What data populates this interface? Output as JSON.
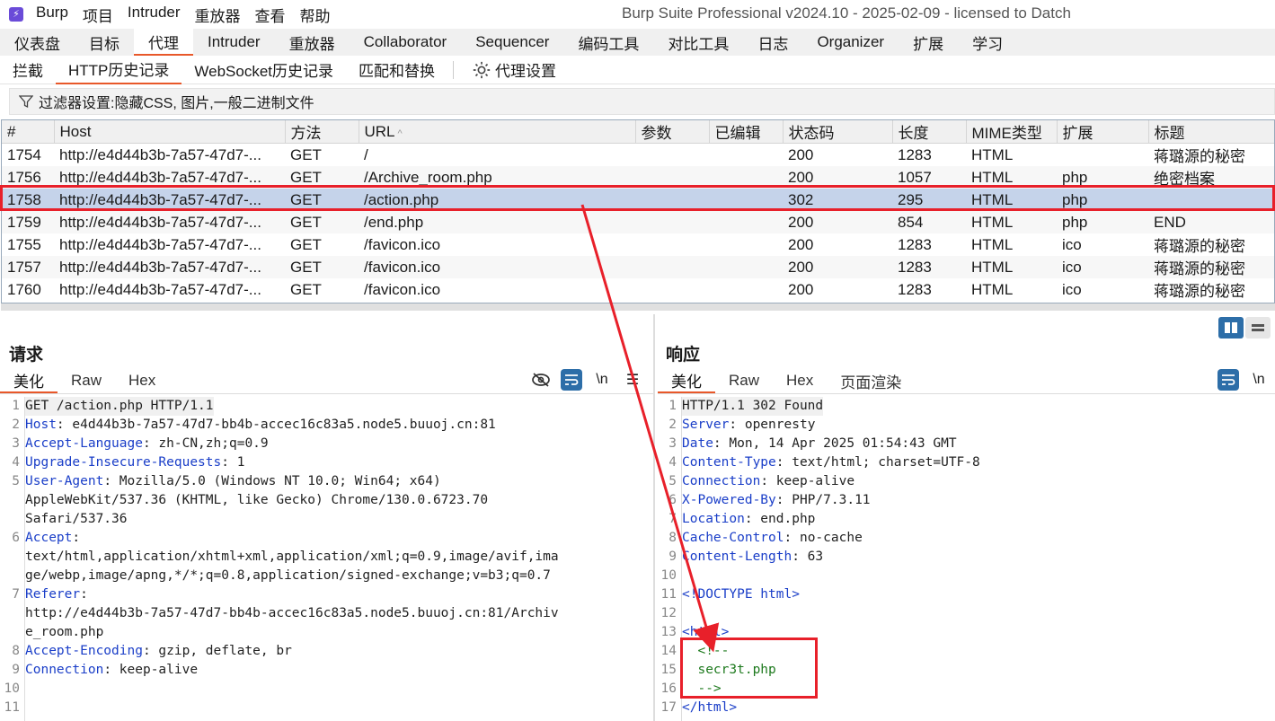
{
  "menubar": {
    "items": [
      "Burp",
      "项目",
      "Intruder",
      "重放器",
      "查看",
      "帮助"
    ],
    "window_title": "Burp Suite Professional v2024.10 - 2025-02-09 - licensed to Datch"
  },
  "main_tabs": [
    {
      "label": "仪表盘"
    },
    {
      "label": "目标"
    },
    {
      "label": "代理",
      "active": true
    },
    {
      "label": "Intruder"
    },
    {
      "label": "重放器"
    },
    {
      "label": "Collaborator"
    },
    {
      "label": "Sequencer"
    },
    {
      "label": "编码工具"
    },
    {
      "label": "对比工具"
    },
    {
      "label": "日志"
    },
    {
      "label": "Organizer"
    },
    {
      "label": "扩展"
    },
    {
      "label": "学习"
    }
  ],
  "sub_tabs": {
    "items": [
      "拦截",
      "HTTP历史记录",
      "WebSocket历史记录",
      "匹配和替换"
    ],
    "active": "HTTP历史记录",
    "settings_label": "代理设置"
  },
  "filter": {
    "text": "过滤器设置:隐藏CSS, 图片,一般二进制文件"
  },
  "history": {
    "columns": [
      "#",
      "Host",
      "方法",
      "URL",
      "参数",
      "已编辑",
      "状态码",
      "长度",
      "MIME类型",
      "扩展",
      "标题"
    ],
    "rows": [
      {
        "num": "1754",
        "host": "http://e4d44b3b-7a57-47d7-...",
        "method": "GET",
        "url": "/",
        "params": "",
        "edited": "",
        "status": "200",
        "length": "1283",
        "mime": "HTML",
        "ext": "",
        "title": "蒋璐源的秘密"
      },
      {
        "num": "1756",
        "host": "http://e4d44b3b-7a57-47d7-...",
        "method": "GET",
        "url": "/Archive_room.php",
        "params": "",
        "edited": "",
        "status": "200",
        "length": "1057",
        "mime": "HTML",
        "ext": "php",
        "title": "绝密档案"
      },
      {
        "num": "1758",
        "host": "http://e4d44b3b-7a57-47d7-...",
        "method": "GET",
        "url": "/action.php",
        "params": "",
        "edited": "",
        "status": "302",
        "length": "295",
        "mime": "HTML",
        "ext": "php",
        "title": ""
      },
      {
        "num": "1759",
        "host": "http://e4d44b3b-7a57-47d7-...",
        "method": "GET",
        "url": "/end.php",
        "params": "",
        "edited": "",
        "status": "200",
        "length": "854",
        "mime": "HTML",
        "ext": "php",
        "title": "END"
      },
      {
        "num": "1755",
        "host": "http://e4d44b3b-7a57-47d7-...",
        "method": "GET",
        "url": "/favicon.ico",
        "params": "",
        "edited": "",
        "status": "200",
        "length": "1283",
        "mime": "HTML",
        "ext": "ico",
        "title": "蒋璐源的秘密"
      },
      {
        "num": "1757",
        "host": "http://e4d44b3b-7a57-47d7-...",
        "method": "GET",
        "url": "/favicon.ico",
        "params": "",
        "edited": "",
        "status": "200",
        "length": "1283",
        "mime": "HTML",
        "ext": "ico",
        "title": "蒋璐源的秘密"
      },
      {
        "num": "1760",
        "host": "http://e4d44b3b-7a57-47d7-...",
        "method": "GET",
        "url": "/favicon.ico",
        "params": "",
        "edited": "",
        "status": "200",
        "length": "1283",
        "mime": "HTML",
        "ext": "ico",
        "title": "蒋璐源的秘密"
      }
    ],
    "selected_row": "1758"
  },
  "request": {
    "title": "请求",
    "tabs": [
      "美化",
      "Raw",
      "Hex"
    ],
    "newline_label": "\\n",
    "lines": [
      {
        "n": "1",
        "parts": [
          {
            "t": "GET /action.php HTTP/1.1",
            "c": "hval"
          }
        ]
      },
      {
        "n": "2",
        "parts": [
          {
            "t": "Host",
            "c": "hkey"
          },
          {
            "t": ": e4d44b3b-7a57-47d7-bb4b-accec16c83a5.node5.buuoj.cn:81",
            "c": "hval"
          }
        ]
      },
      {
        "n": "3",
        "parts": [
          {
            "t": "Accept-Language",
            "c": "hkey"
          },
          {
            "t": ": zh-CN,zh;q=0.9",
            "c": "hval"
          }
        ]
      },
      {
        "n": "4",
        "parts": [
          {
            "t": "Upgrade-Insecure-Requests",
            "c": "hkey"
          },
          {
            "t": ": 1",
            "c": "hval"
          }
        ]
      },
      {
        "n": "5",
        "parts": [
          {
            "t": "User-Agent",
            "c": "hkey"
          },
          {
            "t": ": Mozilla/5.0 (Windows NT 10.0; Win64; x64)",
            "c": "hval"
          }
        ]
      },
      {
        "n": "",
        "parts": [
          {
            "t": "AppleWebKit/537.36 (KHTML, like Gecko) Chrome/130.0.6723.70",
            "c": "hval"
          }
        ]
      },
      {
        "n": "",
        "parts": [
          {
            "t": "Safari/537.36",
            "c": "hval"
          }
        ]
      },
      {
        "n": "6",
        "parts": [
          {
            "t": "Accept",
            "c": "hkey"
          },
          {
            "t": ":",
            "c": "hval"
          }
        ]
      },
      {
        "n": "",
        "parts": [
          {
            "t": "text/html,application/xhtml+xml,application/xml;q=0.9,image/avif,ima",
            "c": "hval"
          }
        ]
      },
      {
        "n": "",
        "parts": [
          {
            "t": "ge/webp,image/apng,*/*;q=0.8,application/signed-exchange;v=b3;q=0.7",
            "c": "hval"
          }
        ]
      },
      {
        "n": "7",
        "parts": [
          {
            "t": "Referer",
            "c": "hkey"
          },
          {
            "t": ":",
            "c": "hval"
          }
        ]
      },
      {
        "n": "",
        "parts": [
          {
            "t": "http://e4d44b3b-7a57-47d7-bb4b-accec16c83a5.node5.buuoj.cn:81/Archiv",
            "c": "hval"
          }
        ]
      },
      {
        "n": "",
        "parts": [
          {
            "t": "e_room.php",
            "c": "hval"
          }
        ]
      },
      {
        "n": "8",
        "parts": [
          {
            "t": "Accept-Encoding",
            "c": "hkey"
          },
          {
            "t": ": gzip, deflate, br",
            "c": "hval"
          }
        ]
      },
      {
        "n": "9",
        "parts": [
          {
            "t": "Connection",
            "c": "hkey"
          },
          {
            "t": ": keep-alive",
            "c": "hval"
          }
        ]
      },
      {
        "n": "10",
        "parts": [
          {
            "t": "",
            "c": "hval"
          }
        ]
      },
      {
        "n": "11",
        "parts": [
          {
            "t": "",
            "c": "hval"
          }
        ]
      }
    ]
  },
  "response": {
    "title": "响应",
    "tabs": [
      "美化",
      "Raw",
      "Hex",
      "页面渲染"
    ],
    "newline_label": "\\n",
    "lines": [
      {
        "n": "1",
        "parts": [
          {
            "t": "HTTP/1.1 302 Found",
            "c": "hval"
          }
        ]
      },
      {
        "n": "2",
        "parts": [
          {
            "t": "Server",
            "c": "hkey"
          },
          {
            "t": ": openresty",
            "c": "hval"
          }
        ]
      },
      {
        "n": "3",
        "parts": [
          {
            "t": "Date",
            "c": "hkey"
          },
          {
            "t": ": Mon, 14 Apr 2025 01:54:43 GMT",
            "c": "hval"
          }
        ]
      },
      {
        "n": "4",
        "parts": [
          {
            "t": "Content-Type",
            "c": "hkey"
          },
          {
            "t": ": text/html; charset=UTF-8",
            "c": "hval"
          }
        ]
      },
      {
        "n": "5",
        "parts": [
          {
            "t": "Connection",
            "c": "hkey"
          },
          {
            "t": ": keep-alive",
            "c": "hval"
          }
        ]
      },
      {
        "n": "6",
        "parts": [
          {
            "t": "X-Powered-By",
            "c": "hkey"
          },
          {
            "t": ": PHP/7.3.11",
            "c": "hval"
          }
        ]
      },
      {
        "n": "7",
        "parts": [
          {
            "t": "Location",
            "c": "hkey"
          },
          {
            "t": ": end.php",
            "c": "hval"
          }
        ]
      },
      {
        "n": "8",
        "parts": [
          {
            "t": "Cache-Control",
            "c": "hkey"
          },
          {
            "t": ": no-cache",
            "c": "hval"
          }
        ]
      },
      {
        "n": "9",
        "parts": [
          {
            "t": "Content-Length",
            "c": "hkey"
          },
          {
            "t": ": 63",
            "c": "hval"
          }
        ]
      },
      {
        "n": "10",
        "parts": [
          {
            "t": "",
            "c": "hval"
          }
        ]
      },
      {
        "n": "11",
        "parts": [
          {
            "t": "<!DOCTYPE html>",
            "c": "htag"
          }
        ]
      },
      {
        "n": "12",
        "parts": [
          {
            "t": "",
            "c": "hval"
          }
        ]
      },
      {
        "n": "13",
        "parts": [
          {
            "t": "<html>",
            "c": "htag"
          }
        ]
      },
      {
        "n": "14",
        "parts": [
          {
            "t": "  <!--",
            "c": "hcomment"
          }
        ]
      },
      {
        "n": "15",
        "parts": [
          {
            "t": "  secr3t.php",
            "c": "hcomment"
          }
        ]
      },
      {
        "n": "16",
        "parts": [
          {
            "t": "  -->",
            "c": "hcomment"
          }
        ]
      },
      {
        "n": "17",
        "parts": [
          {
            "t": "</html>",
            "c": "htag"
          }
        ]
      }
    ]
  },
  "colors": {
    "accent": "#e8582a",
    "selection": "#c5d3ea",
    "annotation": "#e8202a",
    "header_key": "#1a3ec8",
    "comment": "#1e7a1e"
  }
}
